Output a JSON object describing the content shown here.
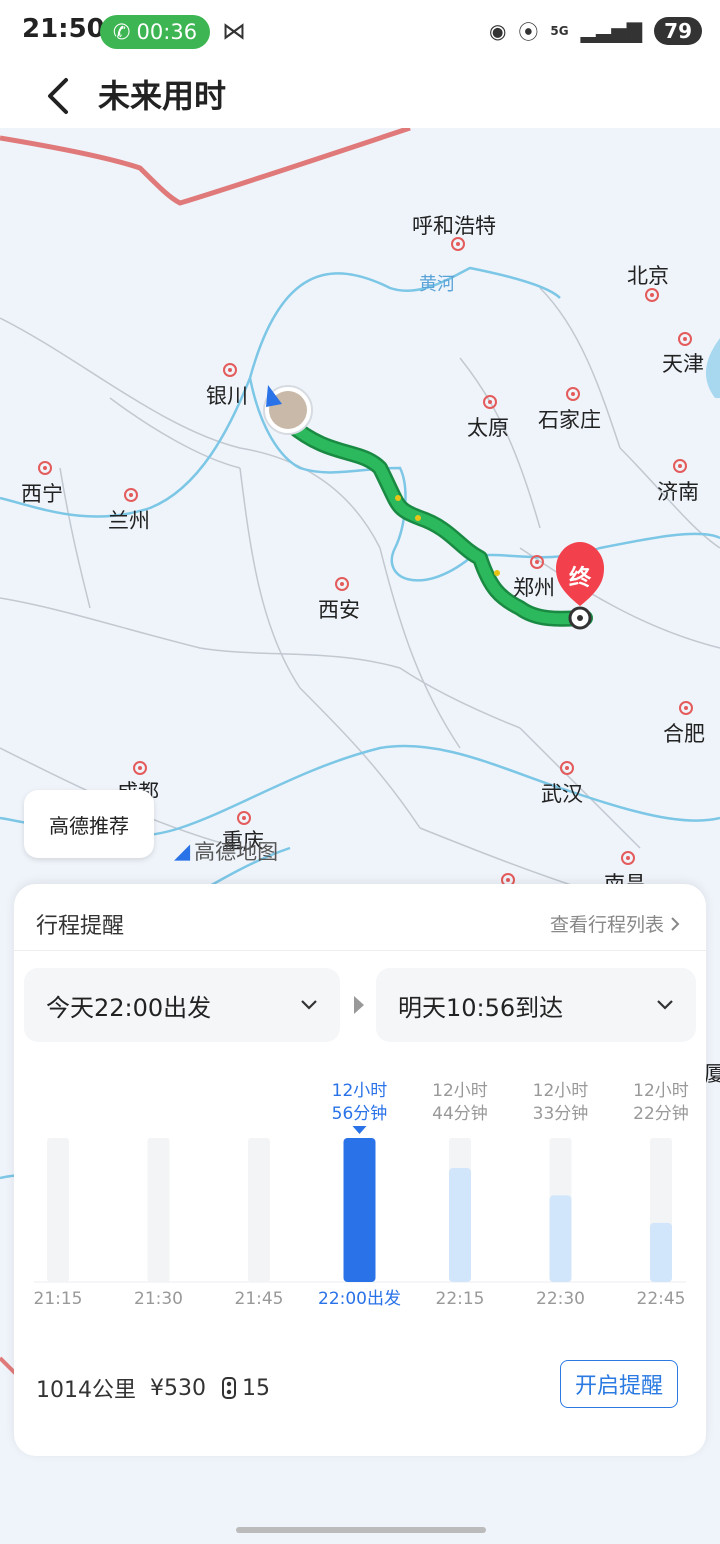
{
  "status_bar": {
    "time": "21:50",
    "call_timer": "00:36",
    "network": "5G",
    "battery": "79",
    "icons": [
      "call-icon",
      "satellite-icon",
      "location-icon",
      "hotspot-icon",
      "signal-icon"
    ]
  },
  "header": {
    "title": "未来用时",
    "back_icon": "chevron-left-icon"
  },
  "map": {
    "cities": [
      "呼和浩特",
      "北京",
      "天津",
      "银川",
      "太原",
      "石家庄",
      "西宁",
      "兰州",
      "济南",
      "郑州",
      "西安",
      "合肥",
      "成都",
      "武汉",
      "重庆",
      "南昌",
      "厦"
    ],
    "river": "黄河",
    "end_marker": "终",
    "recommend_chip": "高德推荐",
    "logo": "高德地图",
    "colors": {
      "route": "#1fad55",
      "border": "#e07a7a",
      "water": "#7cc6e6"
    }
  },
  "trip_card": {
    "title": "行程提醒",
    "list_link": "查看行程列表",
    "depart_select": "今天22:00出发",
    "arrive_select": "明天10:56到达",
    "chart_data": {
      "type": "bar",
      "categories": [
        "21:15",
        "21:30",
        "21:45",
        "22:00出发",
        "22:15",
        "22:30",
        "22:45"
      ],
      "values": [
        null,
        null,
        null,
        776,
        764,
        753,
        742
      ],
      "value_labels_line1": [
        "",
        "",
        "",
        "12小时",
        "12小时",
        "12小时",
        "12小时"
      ],
      "value_labels_line2": [
        "",
        "",
        "",
        "56分钟",
        "44分钟",
        "33分钟",
        "22分钟"
      ],
      "selected_index": 3,
      "colors": {
        "selected": "#2a72e8",
        "future": "#d2e6fb",
        "empty": "#f3f4f6",
        "label_selected": "#2a72e8",
        "label_normal": "#999999"
      },
      "ylim": [
        0,
        820
      ]
    },
    "stats": {
      "distance": "1014公里",
      "toll": "¥530",
      "traffic_lights": "15"
    },
    "remind_button": "开启提醒"
  }
}
